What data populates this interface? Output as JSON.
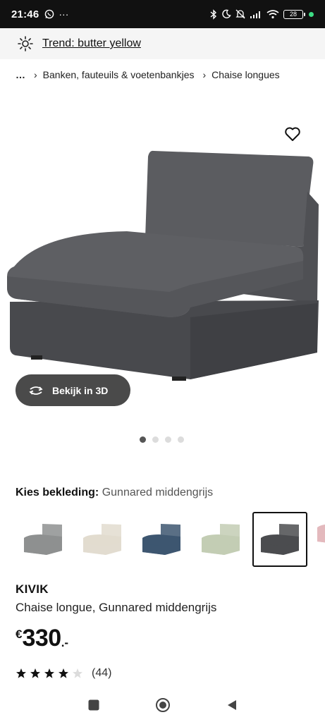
{
  "status_bar": {
    "time": "21:46",
    "left_extra": "···",
    "battery": "28",
    "icons": [
      "whatsapp-icon",
      "bluetooth-icon",
      "moon-icon",
      "bell-off-icon",
      "signal-icon",
      "wifi-icon",
      "battery-icon"
    ]
  },
  "trend": {
    "label": "Trend: butter yellow",
    "icon": "sun-icon"
  },
  "breadcrumb": {
    "items": [
      "…",
      "Banken, fauteuils & voetenbankjes",
      "Chaise longues"
    ],
    "separator": "›"
  },
  "gallery": {
    "view3d_label": "Bekijk in 3D",
    "dots_count": 4,
    "active_dot": 0
  },
  "cover": {
    "label": "Kies bekleding:",
    "value": "Gunnared middengrijs",
    "swatches": [
      {
        "name": "light-grey",
        "color": "#8e9090"
      },
      {
        "name": "beige",
        "color": "#e2dccf"
      },
      {
        "name": "blue",
        "color": "#3d5670"
      },
      {
        "name": "sage-green",
        "color": "#c3cdb4"
      },
      {
        "name": "dark-grey",
        "color": "#4b4c4f",
        "selected": true
      }
    ],
    "partial_swatch_color": "#e3b9bd"
  },
  "product": {
    "brand": "KIVIK",
    "description": "Chaise longue, Gunnared middengrijs",
    "price_currency": "€",
    "price_amount": "330",
    "price_suffix": ".-",
    "rating": 4,
    "rating_max": 5,
    "review_count": "(44)"
  },
  "colors": {
    "sofa": "#55565a",
    "sofa_dark": "#45464a",
    "button_bg": "#4a4a4a",
    "banner_bg": "#f5f5f5"
  }
}
